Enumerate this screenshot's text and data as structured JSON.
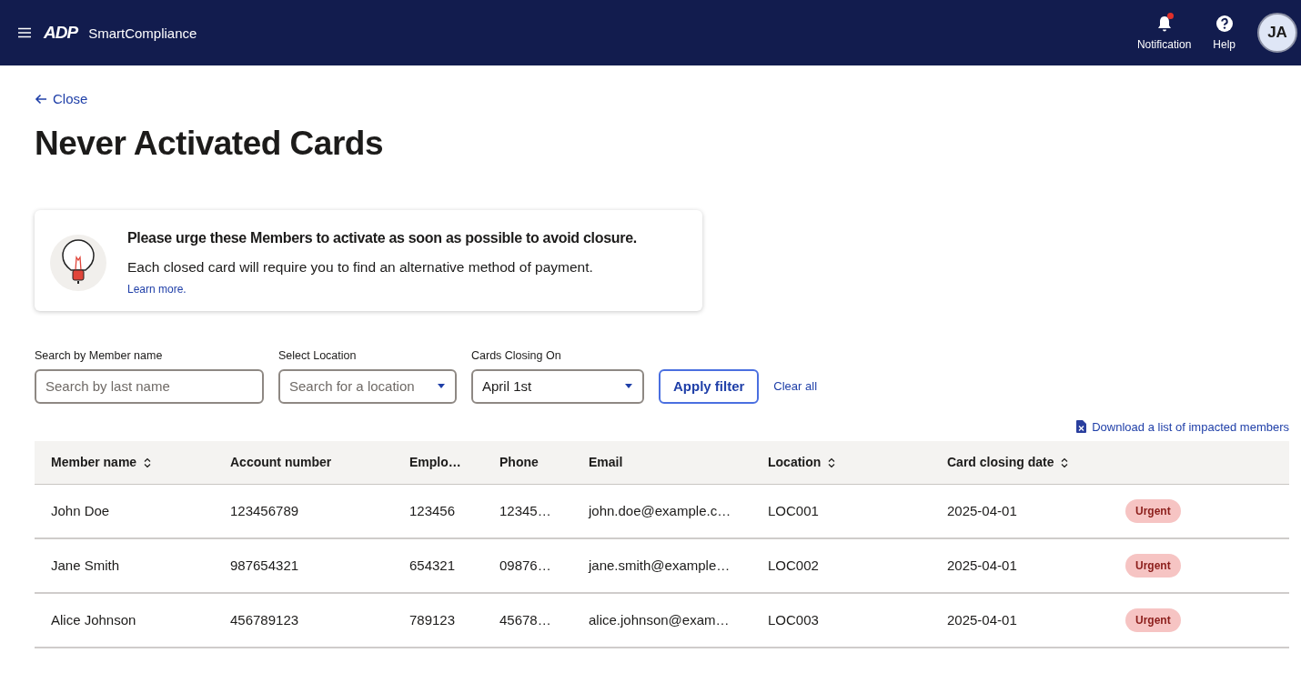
{
  "header": {
    "logo": "ADP",
    "app_name": "SmartCompliance",
    "notification": {
      "label": "Notification",
      "unread": true
    },
    "help": {
      "label": "Help"
    },
    "avatar": "JA"
  },
  "close_link": "Close",
  "title": "Never Activated Cards",
  "notice": {
    "heading": "Please urge these Members to activate as soon as possible to avoid closure.",
    "body": "Each closed card will require you to find an alternative method of payment.",
    "link": "Learn more."
  },
  "filters": [
    {
      "kind": "text",
      "label": "Search by Member name",
      "placeholder": "Search by last name"
    },
    {
      "kind": "select",
      "label": "Select Location",
      "placeholder": "Search for a location"
    },
    {
      "kind": "select",
      "label": "Cards Closing On",
      "value": "April 1st"
    }
  ],
  "apply_button": "Apply filter",
  "clear_link": "Clear all",
  "download_link": "Download a list of impacted members",
  "table": {
    "columns": [
      {
        "label": "Member name",
        "sortable": true
      },
      {
        "label": "Account number",
        "sortable": false
      },
      {
        "label": "Emplo…",
        "sortable": false
      },
      {
        "label": "Phone",
        "sortable": false
      },
      {
        "label": "Email",
        "sortable": false
      },
      {
        "label": "Location",
        "sortable": true
      },
      {
        "label": "Card closing date",
        "sortable": true
      }
    ],
    "rows": [
      {
        "cells": [
          "John Doe",
          "123456789",
          "123456",
          "12345…",
          "john.doe@example.c…",
          "LOC001",
          "2025-04-01"
        ],
        "status": "Urgent"
      },
      {
        "cells": [
          "Jane Smith",
          "987654321",
          "654321",
          "09876…",
          "jane.smith@example…",
          "LOC002",
          "2025-04-01"
        ],
        "status": "Urgent"
      },
      {
        "cells": [
          "Alice Johnson",
          "456789123",
          "789123",
          "45678…",
          "alice.johnson@exam…",
          "LOC003",
          "2025-04-01"
        ],
        "status": "Urgent"
      }
    ]
  }
}
